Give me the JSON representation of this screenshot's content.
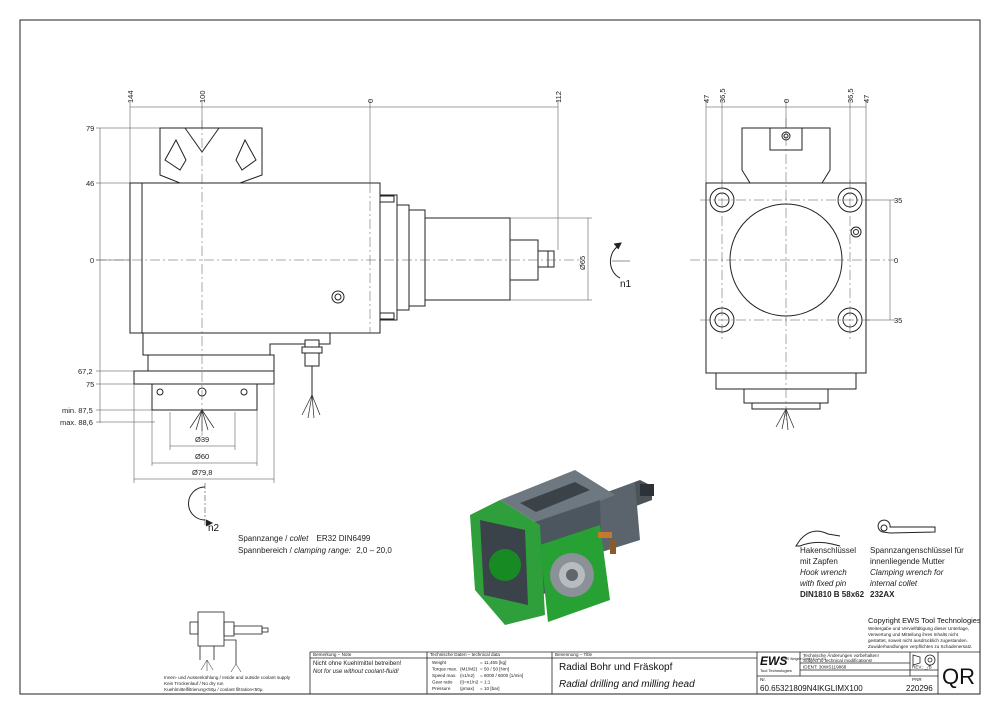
{
  "side_view": {
    "top_dims": [
      "144",
      "100",
      "0",
      "112"
    ],
    "left_dims": [
      "79",
      "46",
      "0",
      "67,2",
      "75",
      "min. 87,5",
      "max. 88,6"
    ],
    "diameters": [
      "Ø39",
      "Ø60",
      "Ø79,8"
    ],
    "shaft_diameter": "Ø65",
    "rotation_n1": "n1",
    "rotation_n2": "n2"
  },
  "front_view": {
    "top_dims": [
      "47",
      "36,5",
      "0",
      "36,5",
      "47"
    ],
    "right_dims": [
      "35",
      "0",
      "35"
    ]
  },
  "collet": {
    "line1_de": "Spannzange /",
    "line1_en": "collet",
    "line1_val": "ER32    DIN6499",
    "line2_de": "Spannbereich /",
    "line2_en": "clamping range:",
    "line2_val": "2,0 – 20,0"
  },
  "tools": {
    "hook": {
      "de1": "Hakenschlüssel",
      "de2": "mit Zapfen",
      "en1": "Hook wrench",
      "en2": "with fixed pin",
      "code": "DIN1810 B 58x62"
    },
    "clamp": {
      "de1": "Spannzangenschlüssel für",
      "de2": "innenliegende Mutter",
      "en1": "Clamping wrench for",
      "en2": "internal collet",
      "code": "232AX"
    }
  },
  "copyright": {
    "title": "Copyright EWS Tool Technologies",
    "l1": "Weitergabe und Vervielfältigung dieser Unterlage,",
    "l2": "Verwertung und Mitteilung ihres Inhalts nicht",
    "l3": "gestattet, soweit nicht ausdrücklich zugestanden.",
    "l4": "Zuwiderhandlungen verpflichten zu Schadenersatz."
  },
  "coolant_legend": {
    "l1": "Innen- und Aussenkühlung / Inside and outside coolant supply",
    "l2": "Kein Trockenlauf / No dry run",
    "l3": "Kuehlmittelfiltrierung<50µ / coolant filtration<50µ"
  },
  "title_block": {
    "note_header": "Bemerkung – Note",
    "note_de": "Nicht ohne Kuehlmittel betreiben!",
    "note_en": "Not for use without coolant-fluid!",
    "tech_header": "Technische Daten – technical data",
    "tech": [
      {
        "label": "Weight",
        "unit": "",
        "value": "= 11,455 [kg]"
      },
      {
        "label": "Torque max.",
        "unit": "(M1/M2)",
        "value": "= 50 / 50 [Nm]"
      },
      {
        "label": "Speed max.",
        "unit": "(n1/n2)",
        "value": "= 6000 / 6000 [1/min]"
      },
      {
        "label": "Gear ratio",
        "unit": "(i)=n1/n2",
        "value": "= 1:1"
      },
      {
        "label": "Pressure",
        "unit": "(pmax)",
        "value": "= 10 [bar]"
      }
    ],
    "name_header": "Benennung – Title",
    "name_de": "Radial Bohr und Fräskopf",
    "name_en": "Radial drilling and milling head",
    "logo": "EWS",
    "logo_sub": "Tool Technologies",
    "company_small": "EWS Weigele GmbH & Co. KG",
    "change_de": "Technische Änderungen vorbehalten!",
    "change_en": "Subject to technical modifications!",
    "ident": "IDENT: 30WS119868",
    "rev": "REV.: _/B",
    "part_no_label": "Nr.",
    "part_no": "60.65321809N4IKGLIMX100",
    "drawing_no_label": "PNR",
    "drawing_no": "220296",
    "qr": "QR"
  }
}
